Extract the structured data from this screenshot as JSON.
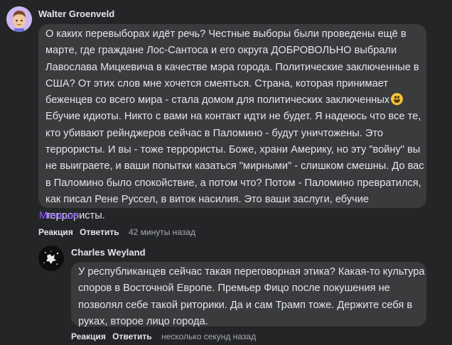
{
  "comments": [
    {
      "author": "Walter Groenveld",
      "avatar_icon": "memoji-avatar-icon",
      "text_lines": [
        "О каких перевыборах идёт речь? Честные выборы были проведены ещё в",
        "марте, где граждане Лос-Сантоса и его округа ДОБРОВОЛЬНО выбрали",
        "Лавослава Мицкевича в качестве мэра города. Политические заключенные в",
        "США? От этих слов мне хочется смеяться. Страна, которая принимает",
        "беженцев со всего мира - стала домом для политических заключенных",
        "Ебучие идиоты. Никто с вами на контакт идти не будет. Я надеюсь что все те,",
        "кто убивают рейнджеров сейчас в Паломино - будут уничтожены. Это",
        "террористы. И вы - тоже террористы. Боже, храни Америку, но эту \"войну\" вы",
        "не выиграете, и ваши попытки казаться \"мирными\" - слишком смешны. До вас",
        "в Паломино было спокойствие, а потом что? Потом - Паломино превратился,",
        "как писал Рене Руссел, в виток насилия. Это ваши заслуги, ебучие террористы."
      ],
      "emoji_icon": "grinning-face-emoji",
      "less_label": "Меньше",
      "reaction_label": "Реакция",
      "reply_label": "Ответить",
      "timestamp": "42 минуты назад"
    },
    {
      "author": "Charles Weyland",
      "avatar_icon": "ink-splatter-avatar-icon",
      "text_lines": [
        "У республиканцев сейчас такая переговорная этика? Какая-то культура",
        "споров в Восточной Европе. Премьер Фицо после покушения не",
        "позволял себе такой риторики. Да и сам Трамп тоже. Держите себя в",
        "руках, второе лицо города."
      ],
      "reaction_label": "Реакция",
      "reply_label": "Ответить",
      "timestamp": "несколько секунд назад"
    }
  ]
}
